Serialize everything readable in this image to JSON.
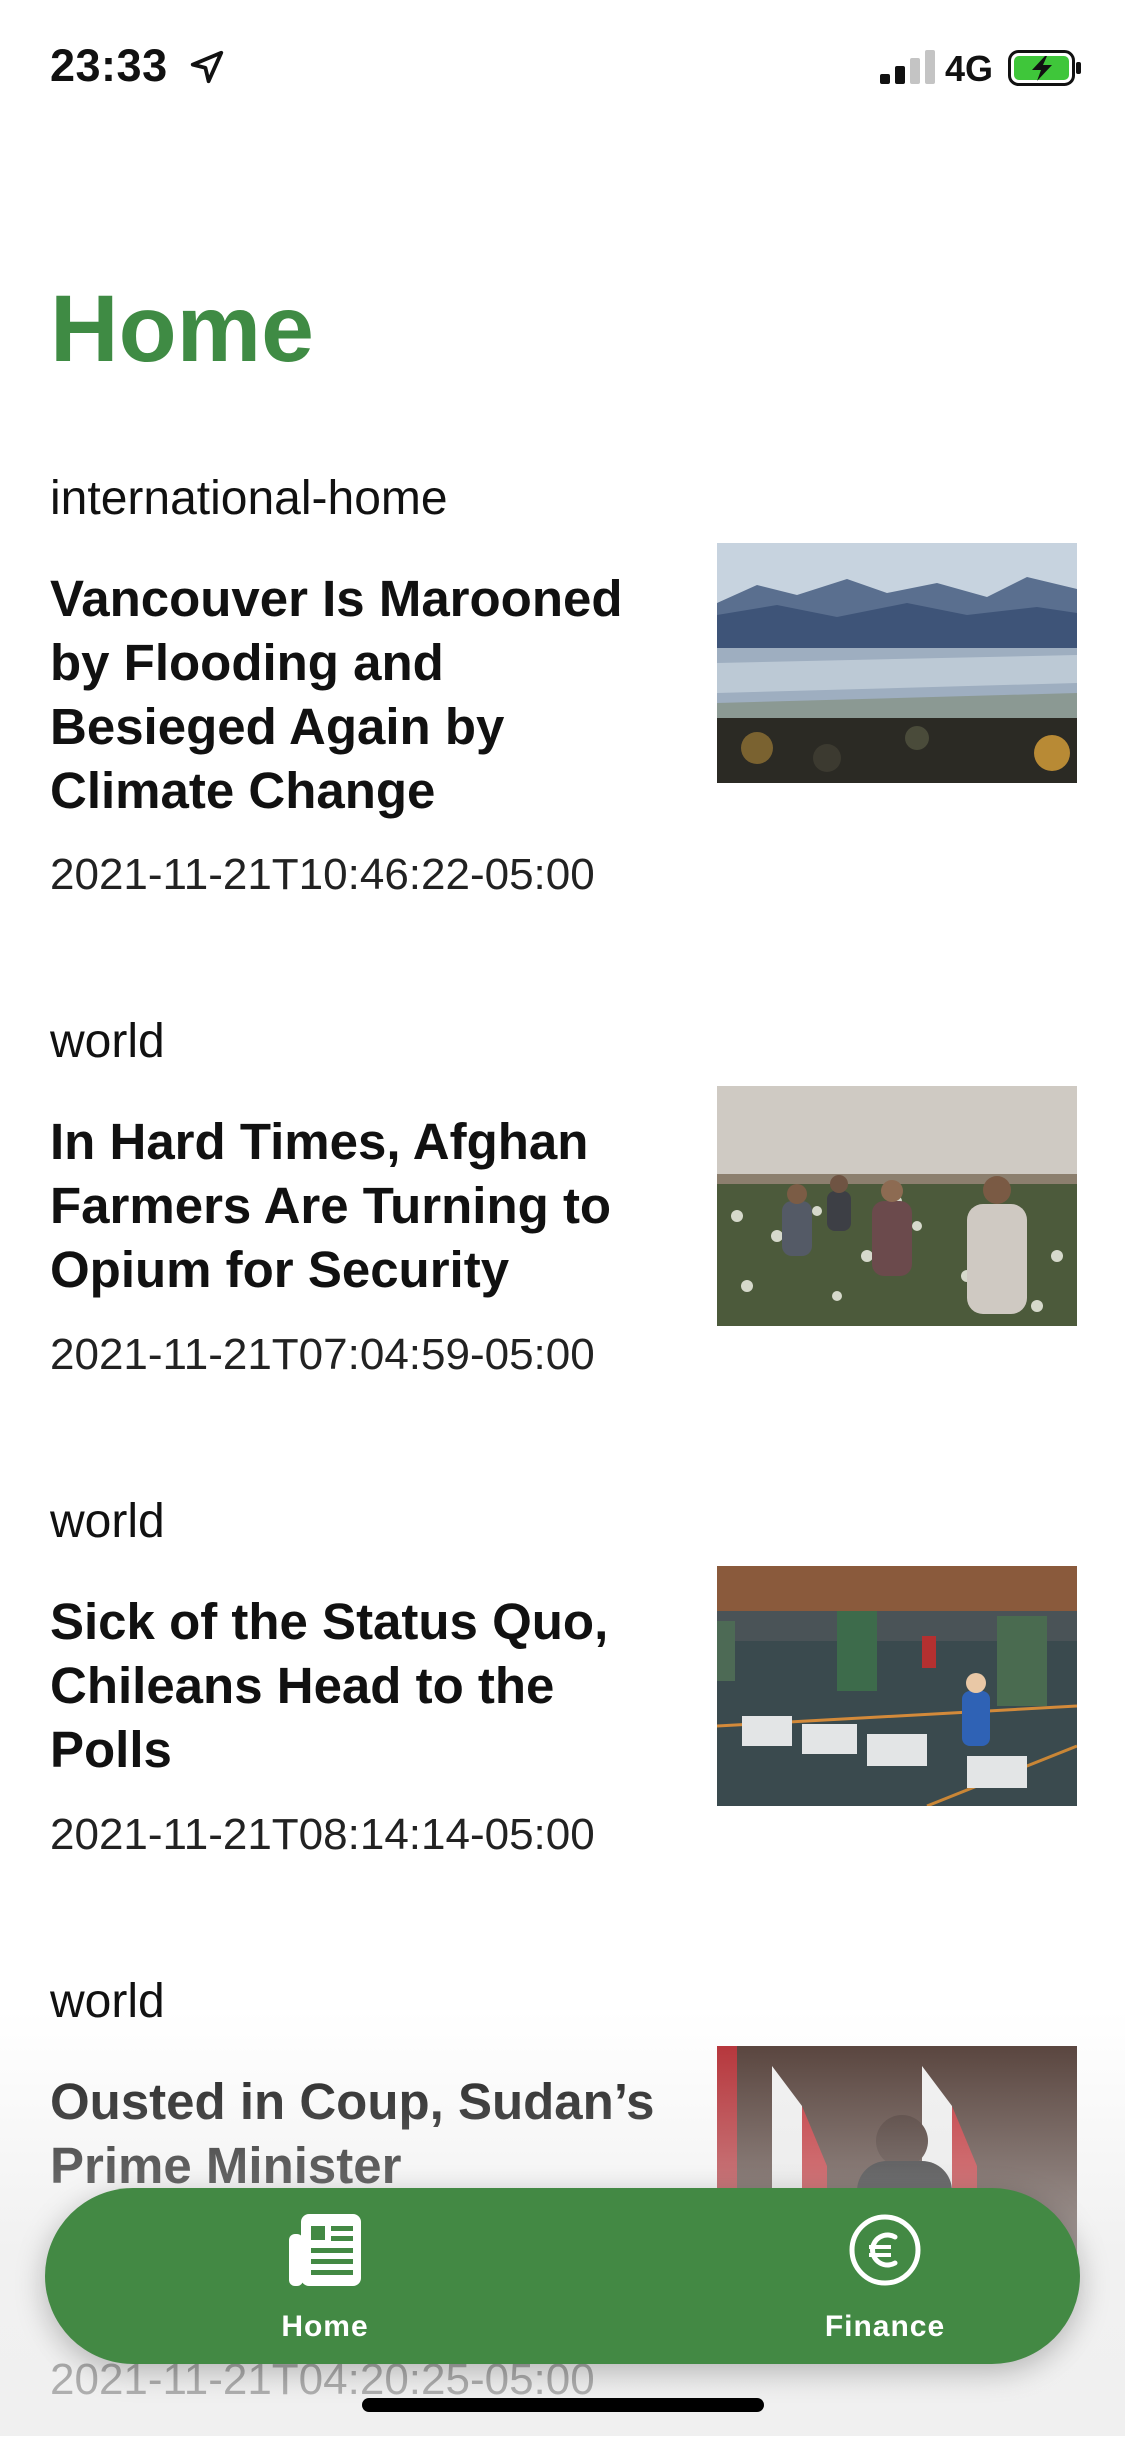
{
  "status_bar": {
    "time": "23:33",
    "network": "4G",
    "icons": [
      "location-arrow-icon",
      "signal-icon",
      "battery-charging-icon"
    ]
  },
  "page": {
    "title": "Home",
    "accent_color": "#3f8b44"
  },
  "articles": [
    {
      "section": "international-home",
      "headline": "Vancouver Is Marooned by Flooding and Besieged Again by Climate Change",
      "date": "2021-11-21T10:46:22-05:00"
    },
    {
      "section": "world",
      "headline": "In Hard Times, Afghan Farmers Are Turning to Opium for Security",
      "date": "2021-11-21T07:04:59-05:00"
    },
    {
      "section": "world",
      "headline": "Sick of the Status Quo, Chileans Head to the Polls",
      "date": "2021-11-21T08:14:14-05:00"
    },
    {
      "section": "world",
      "headline": "Ousted in Coup, Sudan’s Prime Minister",
      "date": "2021-11-21T04:20:25-05:00"
    }
  ],
  "tab_bar": {
    "color": "#438944",
    "tabs": [
      {
        "label": "Home",
        "icon": "newspaper-icon"
      },
      {
        "label": "Finance",
        "icon": "euro-icon"
      }
    ]
  }
}
